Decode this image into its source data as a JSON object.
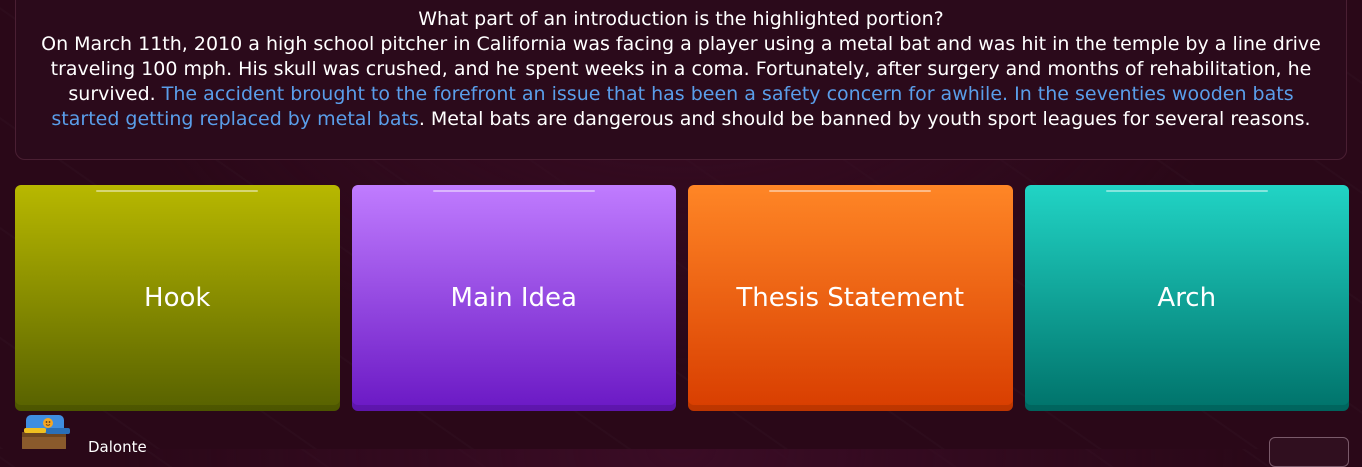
{
  "question": {
    "prompt": "What part of an introduction is the highlighted portion?",
    "passage_before": "On March 11th, 2010 a high school pitcher in California was facing a player using a metal bat and was hit in the temple by a line drive traveling 100 mph. His skull was crushed, and he spent weeks in a coma. Fortunately, after surgery and months of rehabilitation, he survived. ",
    "passage_highlight": "The accident brought to the forefront an issue that has been a safety concern for awhile. In the seventies wooden bats started getting replaced by metal bats",
    "passage_after": ". Metal bats are dangerous and should be banned by youth sport leagues for several reasons.",
    "highlight_color": "#5a9eea"
  },
  "options": [
    {
      "label": "Hook",
      "color": "#b8b800"
    },
    {
      "label": "Main Idea",
      "color": "#a855f7"
    },
    {
      "label": "Thesis Statement",
      "color": "#f26a10"
    },
    {
      "label": "Arch",
      "color": "#12b3a6"
    }
  ],
  "player": {
    "name": "Dalonte",
    "avatar_icon": "player-avatar-icon"
  }
}
